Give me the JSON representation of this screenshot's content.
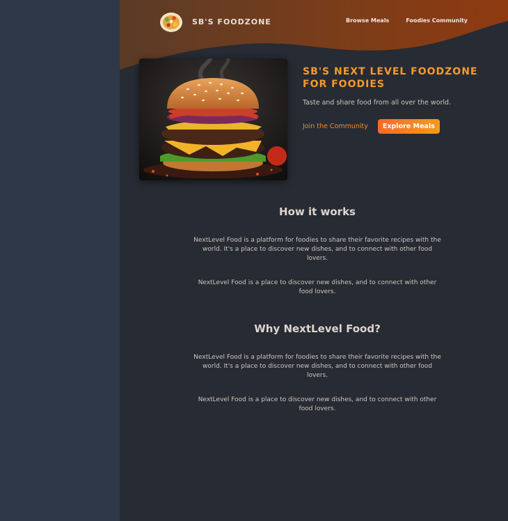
{
  "header": {
    "brand": "SB'S FOODZONE",
    "nav": [
      "Browse Meals",
      "Foodies Community"
    ]
  },
  "hero": {
    "title": "SB'S NEXT LEVEL FOODZONE FOR FOODIES",
    "subtitle": "Taste and share food from all over the world.",
    "join_link": "Join the Community",
    "explore_button": "Explore Meals"
  },
  "how": {
    "title": "How it works",
    "p1": "NextLevel Food is a platform for foodies to share their favorite recipes with the world. It's a place to discover new dishes, and to connect with other food lovers.",
    "p2": "NextLevel Food is a place to discover new dishes, and to connect with other food lovers."
  },
  "why": {
    "title": "Why NextLevel Food?",
    "p1": "NextLevel Food is a platform for foodies to share their favorite recipes with the world. It's a place to discover new dishes, and to connect with other food lovers.",
    "p2": "NextLevel Food is a place to discover new dishes, and to connect with other food lovers."
  },
  "colors": {
    "accent": "#f59a2c",
    "header_gradient_start": "#5a3a24",
    "header_gradient_end": "#8e3a10",
    "page_bg": "#272b33"
  },
  "icons": {
    "logo": "food-plate-logo",
    "hero_image": "burger-image"
  }
}
